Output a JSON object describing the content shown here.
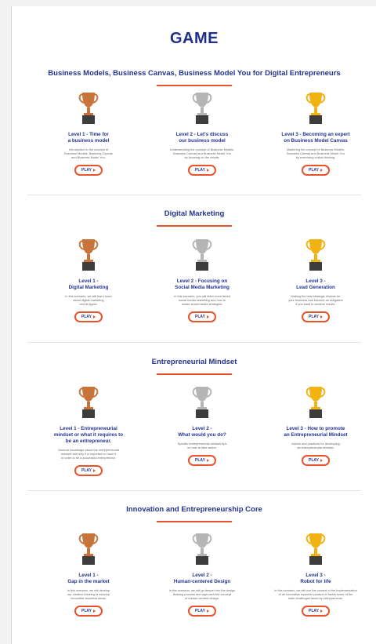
{
  "page_title": "GAME",
  "play_label": "PLAY",
  "colors": {
    "heading": "#1f2f8c",
    "accent": "#e8532a",
    "bronze": "#c8733a",
    "silver": "#b5b5b5",
    "gold": "#f2b312",
    "base": "#3d3d3d"
  },
  "sections": [
    {
      "heading": "Business Models, Business Canvas, Business Model You for Digital Entrepreneurs",
      "levels": [
        {
          "title": "Level 1 - Time for\na business model",
          "desc": "Introduction to the concept of\nBusiness Models, Business Canvas\nand Business Model You.",
          "trophy": "bronze-trophy-icon"
        },
        {
          "title": "Level 2 - Let's discuss\nour business model",
          "desc": "Understanding the concept of Business Models,\nBusiness Canvas and Business Model You\nby focusing on the details.",
          "trophy": "silver-trophy-icon"
        },
        {
          "title": "Level 3 - Becoming an expert\non Business Model Canvas",
          "desc": "Mastering the concept of Business Models,\nBusiness Canvas and Business Model You\nby exercising critical thinking.",
          "trophy": "gold-trophy-icon"
        }
      ]
    },
    {
      "heading": "Digital Marketing",
      "levels": [
        {
          "title": "Level 1 -\nDigital Marketing",
          "desc": "In this scenario, we will learn more\nabout digital marketing\nand its types.",
          "trophy": "bronze-trophy-icon"
        },
        {
          "title": "Level 2 - Focusing on\nSocial Media Marketing",
          "desc": "In this scenario, you will learn more about\nsocial media marketing and how to\ncreate social media strategies.",
          "trophy": "silver-trophy-icon"
        },
        {
          "title": "Level 3 -\nLead Generation",
          "desc": "Making the best strategic choices for\nyour business has become an obligation\nif you want to achieve results.",
          "trophy": "gold-trophy-icon"
        }
      ]
    },
    {
      "heading": "Entrepreneurial Mindset",
      "levels": [
        {
          "title": "Level 1 - Entrepreneurial\nmindset or what it requires to\nbe an entrepreneur.",
          "desc": "General knowledge about the entrepreneurial\nmindset and why it is important to have it\nin order to be a successful entrepreneur.",
          "trophy": "bronze-trophy-icon"
        },
        {
          "title": "Level 2 -\nWhat would you do?",
          "desc": "Specific entrepreneurial mindset tips\non how to take action.",
          "trophy": "silver-trophy-icon"
        },
        {
          "title": "Level 3 - How to promote\nan Entrepreneurial Mindset",
          "desc": "Advice and practices for developing\nan entrepreneurial mindset.",
          "trophy": "gold-trophy-icon"
        }
      ]
    },
    {
      "heading": "Innovation and Entrepreneurship Core",
      "levels": [
        {
          "title": "Level 1 -\nGap in the market",
          "desc": "In this scenario, we will develop\nour creative thinking to develop\ninnovative business ideas.",
          "trophy": "bronze-trophy-icon"
        },
        {
          "title": "Level 2 -\nHuman-centered Design",
          "desc": "In this scenario, we will go deeper into the design\nthinking process and approach the concept\nof human centred design.",
          "trophy": "silver-trophy-icon"
        },
        {
          "title": "Level 3 -\nRobot for life",
          "desc": "In this scenario, we will use the context of the implementation\nof an innovative business product to tackle some of the\nmain challenges faced by entrepreneurs.",
          "trophy": "gold-trophy-icon"
        }
      ]
    }
  ]
}
